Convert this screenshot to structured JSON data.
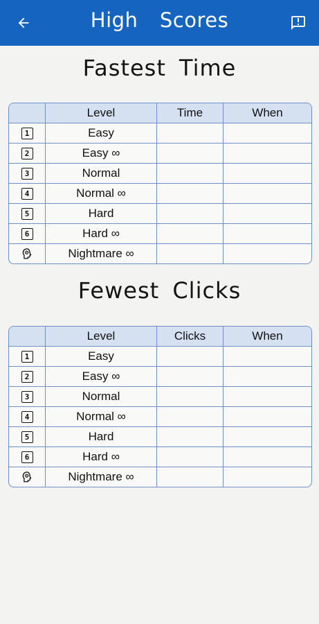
{
  "header": {
    "title": "High  Scores",
    "back_icon": "arrow-left-icon",
    "feedback_icon": "feedback-icon",
    "bar_color": "#1565c0"
  },
  "fastest_time": {
    "title": "Fastest  Time",
    "columns": [
      "",
      "Level",
      "Time",
      "When"
    ],
    "rows": [
      {
        "badge": "1",
        "level": "Easy",
        "value": "",
        "when": ""
      },
      {
        "badge": "2",
        "level": "Easy ∞",
        "value": "",
        "when": ""
      },
      {
        "badge": "3",
        "level": "Normal",
        "value": "",
        "when": ""
      },
      {
        "badge": "4",
        "level": "Normal ∞",
        "value": "",
        "when": ""
      },
      {
        "badge": "5",
        "level": "Hard",
        "value": "",
        "when": ""
      },
      {
        "badge": "6",
        "level": "Hard ∞",
        "value": "",
        "when": ""
      },
      {
        "badge": "",
        "level": "Nightmare ∞",
        "value": "",
        "when": ""
      }
    ]
  },
  "fewest_clicks": {
    "title": "Fewest  Clicks",
    "columns": [
      "",
      "Level",
      "Clicks",
      "When"
    ],
    "rows": [
      {
        "badge": "1",
        "level": "Easy",
        "value": "",
        "when": ""
      },
      {
        "badge": "2",
        "level": "Easy ∞",
        "value": "",
        "when": ""
      },
      {
        "badge": "3",
        "level": "Normal",
        "value": "",
        "when": ""
      },
      {
        "badge": "4",
        "level": "Normal ∞",
        "value": "",
        "when": ""
      },
      {
        "badge": "5",
        "level": "Hard",
        "value": "",
        "when": ""
      },
      {
        "badge": "6",
        "level": "Hard ∞",
        "value": "",
        "when": ""
      },
      {
        "badge": "",
        "level": "Nightmare ∞",
        "value": "",
        "when": ""
      }
    ]
  }
}
